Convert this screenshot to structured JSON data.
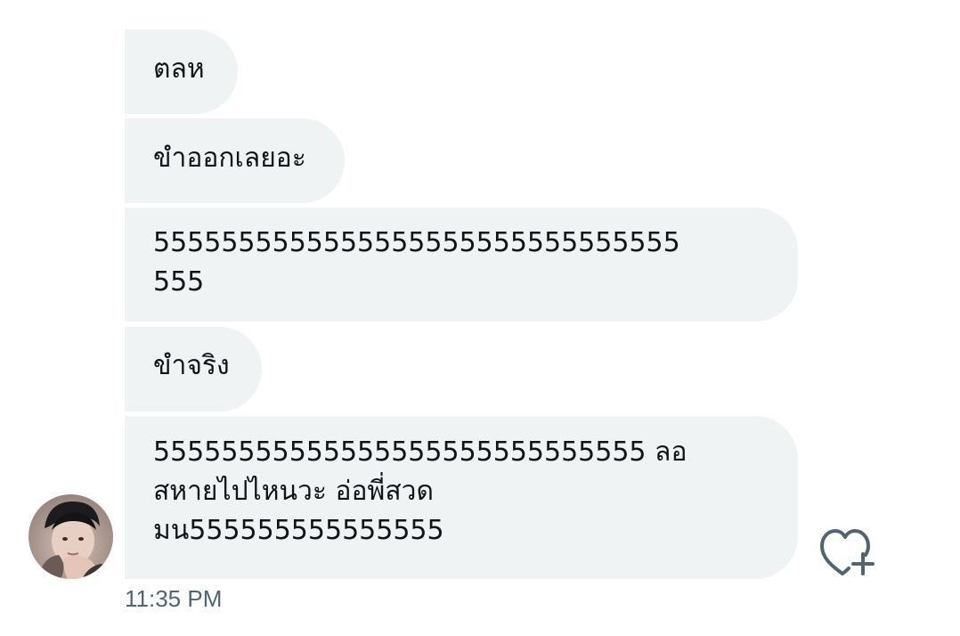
{
  "messages": [
    {
      "lines": [
        "ตลห"
      ]
    },
    {
      "lines": [
        "ขำออกเลยอะ"
      ]
    },
    {
      "lines": [
        "5555555555555555555555555555555",
        "555"
      ]
    },
    {
      "lines": [
        "ขำจริง"
      ]
    },
    {
      "lines": [
        "55555555555555555555555555555 ลอ",
        "สหายไปไหนวะ อ่อพี่สวด",
        "มน555555555555555"
      ]
    }
  ],
  "timestamp": "11:35 PM",
  "icons": {
    "react": "heart-plus-icon",
    "avatar": "avatar"
  },
  "colors": {
    "bubble": "#eff3f4",
    "text": "#0f1419",
    "muted": "#536471",
    "background": "#ffffff"
  }
}
